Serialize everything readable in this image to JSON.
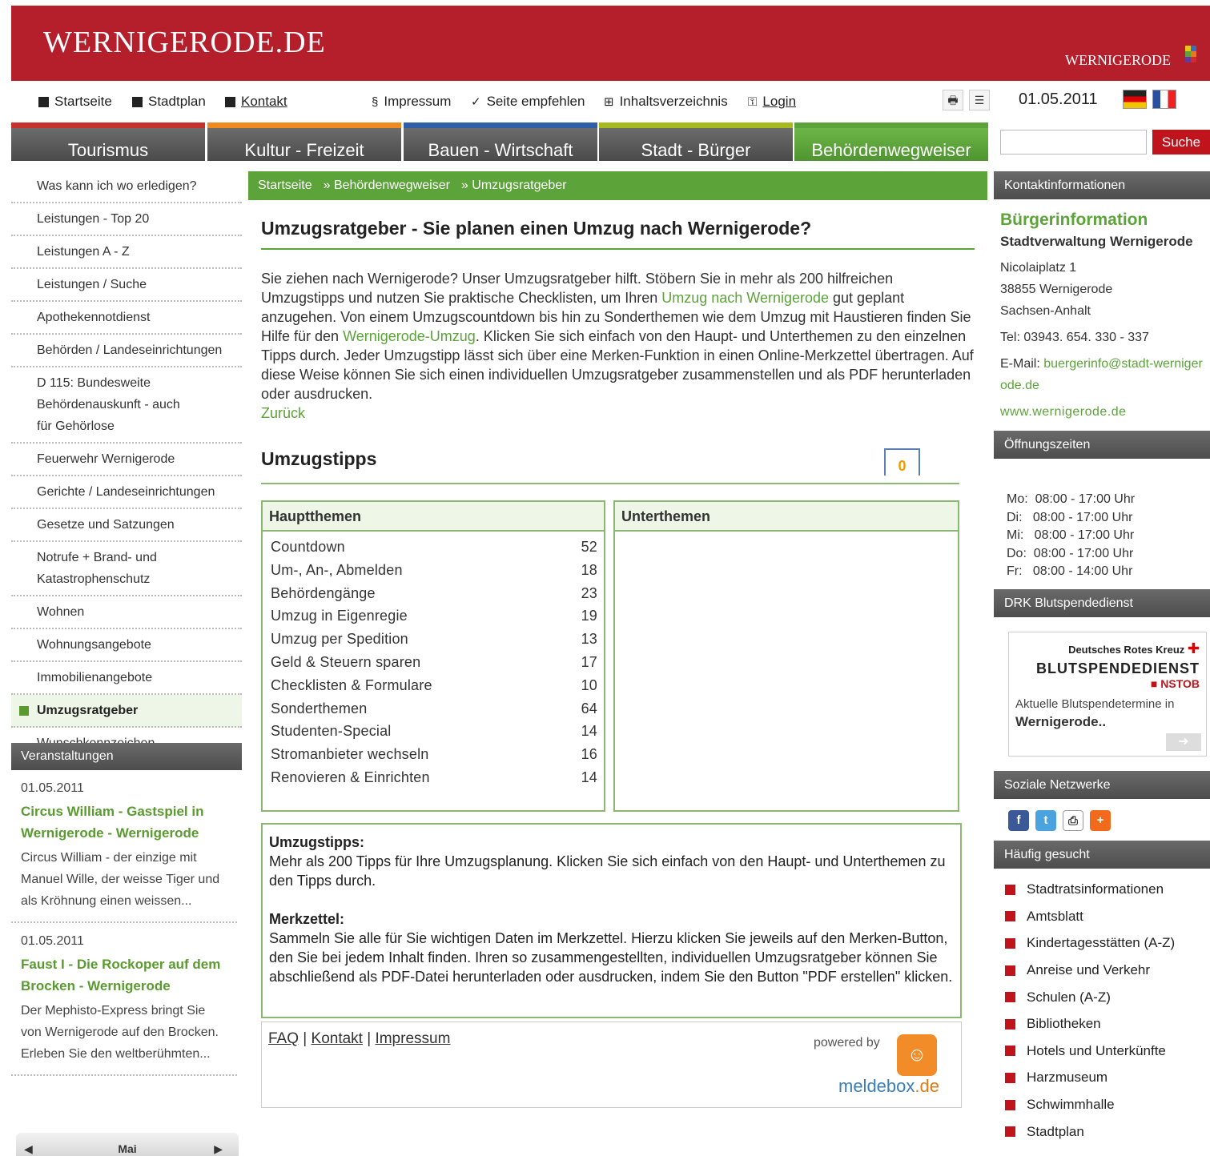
{
  "header": {
    "site_title": "WERNIGERODE.DE",
    "logo_text": "WERNIGERODE"
  },
  "topnav": {
    "startseite": "Startseite",
    "stadtplan": "Stadtplan",
    "kontakt": "Kontakt",
    "impressum": "Impressum",
    "seite_empfehlen": "Seite empfehlen",
    "inhaltsverzeichnis": "Inhaltsverzeichnis",
    "login": "Login",
    "date": "01.05.2011"
  },
  "mainnav": [
    {
      "label": "Tourismus",
      "color": "#c8302c"
    },
    {
      "label": "Kultur - Freizeit",
      "color": "#ef8a1f"
    },
    {
      "label": "Bauen - Wirtschaft",
      "color": "#2f5fa8"
    },
    {
      "label": "Stadt - Bürger",
      "color": "#a6b91f"
    },
    {
      "label": "Behördenwegweiser",
      "color": "#5ca33a"
    }
  ],
  "search": {
    "button": "Suche",
    "placeholder": ""
  },
  "leftnav": [
    "Was kann ich wo erledigen?",
    "Leistungen - Top 20",
    "Leistungen A - Z",
    "Leistungen / Suche",
    "Apothekennotdienst",
    "Behörden / Landeseinrichtungen",
    "D 115: Bundesweite Behördenauskunft - auch für Gehörlose",
    "Feuerwehr Wernigerode",
    "Gerichte / Landeseinrichtungen",
    "Gesetze und Satzungen",
    "Notrufe + Brand- und Katastrophenschutz",
    "Wohnen",
    "Wohnungsangebote",
    "Immobilienangebote",
    "Umzugsratgeber",
    "Wunschkennzeichen"
  ],
  "events": {
    "heading": "Veranstaltungen",
    "items": [
      {
        "date": "01.05.2011",
        "title": "Circus William - Gastspiel in Wernigerode - Wernigerode",
        "text": "Circus William - der einzige mit Manuel Wille, der weisse Tiger und als Kröhnung einen weissen..."
      },
      {
        "date": "01.05.2011",
        "title": "Faust I - Die Rockoper auf dem Brocken - Wernigerode",
        "text": "Der Mephisto-Express bringt Sie von Wernigerode auf den Brocken. Erleben Sie den weltberühmten..."
      }
    ],
    "calendar_month": "Mai"
  },
  "breadcrumb": [
    "Startseite",
    "» Behördenwegweiser",
    "» Umzugsratgeber"
  ],
  "content": {
    "title": "Umzugsratgeber - Sie planen einen Umzug nach Wernigerode?",
    "intro_1": "Sie ziehen nach Wernigerode? Unser Umzugsratgeber hilft. Stöbern Sie in mehr als 200 hilfreichen Umzugstipps und nutzen Sie praktische Checklisten, um Ihren ",
    "intro_link_1": "Umzug nach Wernigerode",
    "intro_2": " gut geplant anzugehen. Von einem Umzugscountdown bis hin zu Sonderthemen wie dem Umzug mit Haustieren finden Sie Hilfe für den ",
    "intro_link_2": "Wernigerode-Umzug",
    "intro_3": ". Klicken Sie sich einfach von den Haupt- und Unterthemen zu den einzelnen Tipps durch. Jeder Umzugstipp lässt sich über eine Merken-Funktion in einen Online-Merkzettel übertragen. Auf diese Weise können Sie sich einen individuellen Umzugsratgeber zusammenstellen und als PDF herunterladen oder ausdrucken.",
    "back_link": "Zurück",
    "tips_title": "Umzugstipps",
    "counter": "0",
    "main_topics_head": "Hauptthemen",
    "sub_topics_head": "Unterthemen",
    "topics": [
      {
        "name": "Countdown",
        "count": "52"
      },
      {
        "name": "Um-, An-, Abmelden",
        "count": "18"
      },
      {
        "name": "Behördengänge",
        "count": "23"
      },
      {
        "name": "Umzug in Eigenregie",
        "count": "19"
      },
      {
        "name": "Umzug per Spedition",
        "count": "13"
      },
      {
        "name": "Geld & Steuern sparen",
        "count": "17"
      },
      {
        "name": "Checklisten & Formulare",
        "count": "10"
      },
      {
        "name": "Sonderthemen",
        "count": "64"
      },
      {
        "name": "Studenten-Special",
        "count": "14"
      },
      {
        "name": "Stromanbieter wechseln",
        "count": "16"
      },
      {
        "name": "Renovieren & Einrichten",
        "count": "14"
      }
    ],
    "info_head_1": "Umzugstipps:",
    "info_text_1": "Mehr als 200 Tipps für Ihre Umzugsplanung. Klicken Sie sich einfach von den Haupt- und Unterthemen zu den Tipps durch.",
    "info_head_2": "Merkzettel:",
    "info_text_2": "Sammeln Sie alle für Sie wichtigen Daten im Merkzettel. Hierzu klicken Sie jeweils auf den Merken-Button, den Sie bei jedem Inhalt finden. Ihren so zusammengestellten, individuellen Umzugsratgeber können Sie abschließend als PDF-Datei herunterladen oder ausdrucken, indem Sie den Button \"PDF erstellen\" klicken.",
    "footer_faq": "FAQ",
    "footer_kontakt": "Kontakt",
    "footer_impressum": "Impressum",
    "powered_by": "powered by",
    "meldebox_a": "meldebox",
    "meldebox_b": ".de"
  },
  "right": {
    "contact_head": "Kontaktinformationen",
    "contact_title": "Bürgerinformation",
    "contact_org": "Stadtverwaltung Wernigerode",
    "street": "Nicolaiplatz 1",
    "city": "38855 Wernigerode",
    "state": "Sachsen-Anhalt",
    "tel": "Tel: 03943. 654. 330 - 337",
    "email_label": "E-Mail: ",
    "email": "buergerinfo@stadt-wernigerode.de",
    "web": "www.wernigerode.de",
    "hours_head": "Öffnungszeiten",
    "hours": [
      "Mo:  08:00 - 17:00 Uhr",
      "Di:   08:00 - 17:00 Uhr",
      "Mi:   08:00 - 17:00 Uhr",
      "Do:  08:00 - 17:00 Uhr",
      "Fr:   08:00 - 14:00 Uhr"
    ],
    "drk_head": "DRK Blutspendedienst",
    "drk_org": "Deutsches Rotes Kreuz",
    "drk_title": "BLUTSPENDEDIENST",
    "drk_nstob": "NSTOB",
    "drk_text": "Aktuelle Blutspendetermine in",
    "drk_text2": "Wernigerode..",
    "social_head": "Soziale Netzwerke",
    "faq_head": "Häufig gesucht",
    "faq": [
      "Stadtratsinformationen",
      "Amtsblatt",
      "Kindertagesstätten (A-Z)",
      "Anreise und Verkehr",
      "Schulen (A-Z)",
      "Bibliotheken",
      "Hotels und Unterkünfte",
      "Harzmuseum",
      "Schwimmhalle",
      "Stadtplan"
    ]
  }
}
